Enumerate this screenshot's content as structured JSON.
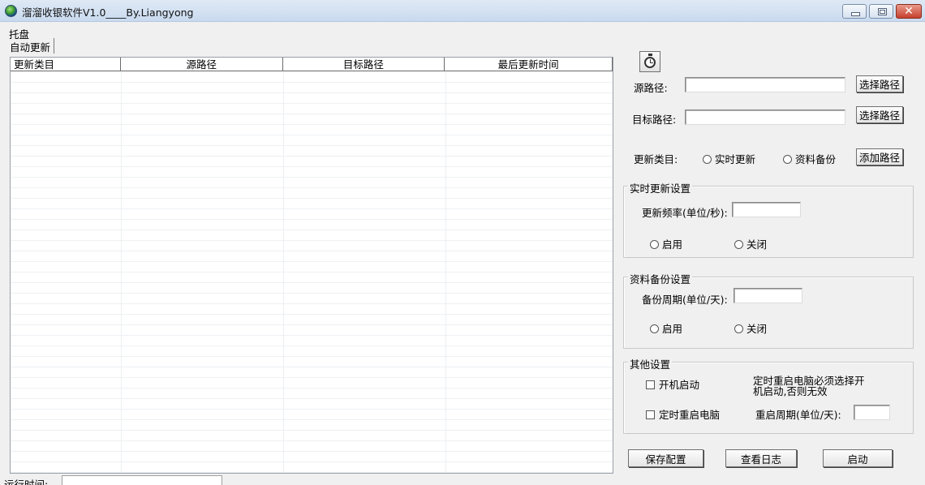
{
  "window": {
    "title": "溜溜收银软件V1.0____By.Liangyong",
    "close_glyph": "✕"
  },
  "menu": {
    "tray_label": "托盘"
  },
  "tabs": [
    {
      "label": "自动更新"
    }
  ],
  "list": {
    "columns": [
      "更新类目",
      "源路径",
      "目标路径",
      "最后更新时间"
    ],
    "rows": []
  },
  "form": {
    "source_label": "源路径:",
    "source_value": "",
    "target_label": "目标路径:",
    "target_value": "",
    "select_path_button": "选择路径",
    "category_label": "更新类目:",
    "category_options": [
      "实时更新",
      "资料备份"
    ],
    "add_path_button": "添加路径"
  },
  "realtime_group": {
    "title": "实时更新设置",
    "frequency_label": "更新频率(单位/秒):",
    "frequency_value": "",
    "enable_label": "启用",
    "disable_label": "关闭"
  },
  "backup_group": {
    "title": "资料备份设置",
    "period_label": "备份周期(单位/天):",
    "period_value": "",
    "enable_label": "启用",
    "disable_label": "关闭"
  },
  "other_group": {
    "title": "其他设置",
    "autostart_label": "开机启动",
    "note_line1": "定时重启电脑必须选择开",
    "note_line2": "机启动,否则无效",
    "scheduled_restart_label": "定时重启电脑",
    "restart_period_label": "重启周期(单位/天):",
    "restart_period_value": ""
  },
  "actions": {
    "save_config": "保存配置",
    "view_log": "查看日志",
    "start": "启动"
  },
  "status": {
    "runtime_label": "运行时间:",
    "runtime_value": ""
  }
}
